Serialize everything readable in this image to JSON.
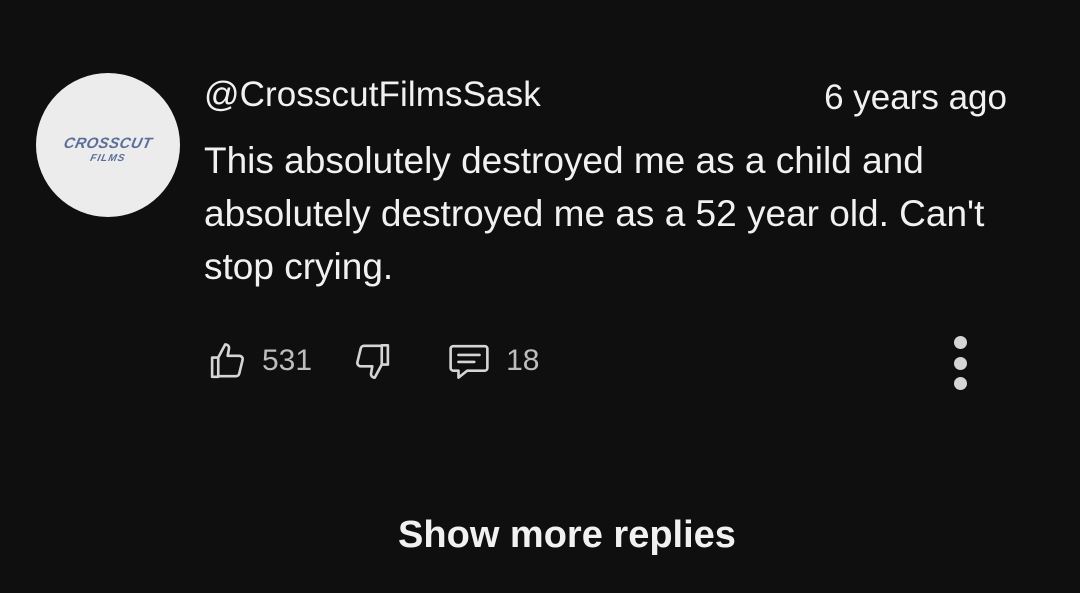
{
  "comment": {
    "avatar_text": [
      "CROSSCUT",
      "FILMS"
    ],
    "author": "@CrosscutFilmsSask",
    "timestamp": "6 years ago",
    "text": "This absolutely destroyed me as a child and absolutely destroyed me as a 52 year old. Can't stop crying.",
    "likes": "531",
    "replies": "18",
    "icons": {
      "like": "thumbs-up-icon",
      "dislike": "thumbs-down-icon",
      "reply": "reply-icon",
      "more": "more-vertical-icon"
    }
  },
  "show_more_label": "Show more replies"
}
